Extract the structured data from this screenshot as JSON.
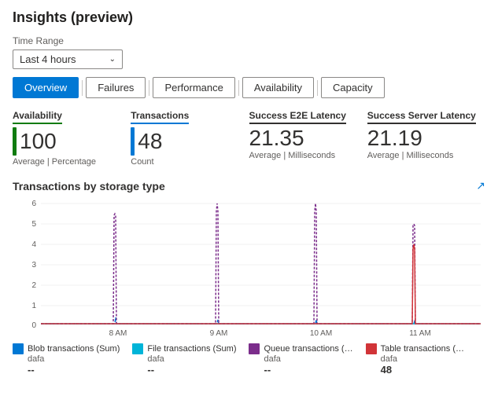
{
  "page": {
    "title": "Insights (preview)"
  },
  "time_range": {
    "label": "Time Range",
    "value": "Last 4 hours"
  },
  "tabs": [
    {
      "id": "overview",
      "label": "Overview",
      "active": true
    },
    {
      "id": "failures",
      "label": "Failures",
      "active": false
    },
    {
      "id": "performance",
      "label": "Performance",
      "active": false
    },
    {
      "id": "availability",
      "label": "Availability",
      "active": false
    },
    {
      "id": "capacity",
      "label": "Capacity",
      "active": false
    }
  ],
  "metrics": [
    {
      "id": "availability",
      "title": "Availability",
      "value": "100",
      "sub": "Average | Percentage",
      "bar_color": "#107c10"
    },
    {
      "id": "transactions",
      "title": "Transactions",
      "value": "48",
      "sub": "Count",
      "bar_color": "#0078d4"
    },
    {
      "id": "e2e_latency",
      "title": "Success E2E Latency",
      "value": "21.35",
      "sub": "Average | Milliseconds",
      "bar_color": null
    },
    {
      "id": "server_latency",
      "title": "Success Server Latency",
      "value": "21.19",
      "sub": "Average | Milliseconds",
      "bar_color": null
    }
  ],
  "chart": {
    "title": "Transactions by storage type",
    "y_labels": [
      "0",
      "1",
      "2",
      "3",
      "4",
      "5",
      "6"
    ],
    "x_labels": [
      "8 AM",
      "9 AM",
      "10 AM",
      "11 AM"
    ],
    "series": [
      {
        "id": "blob",
        "color": "#0078d4",
        "dash": "4,2"
      },
      {
        "id": "file",
        "color": "#00b4d8",
        "dash": "none"
      },
      {
        "id": "queue",
        "color": "#7b2d8b",
        "dash": "4,2"
      },
      {
        "id": "table",
        "color": "#d13438",
        "dash": "none"
      }
    ]
  },
  "legend": [
    {
      "id": "blob",
      "label": "Blob transactions (Sum)",
      "sub": "dafa",
      "value": "--",
      "color": "#0078d4"
    },
    {
      "id": "file",
      "label": "File transactions (Sum)",
      "sub": "dafa",
      "value": "--",
      "color": "#00b4d8"
    },
    {
      "id": "queue",
      "label": "Queue transactions (…",
      "sub": "dafa",
      "value": "--",
      "color": "#7b2d8b"
    },
    {
      "id": "table",
      "label": "Table transactions (…",
      "sub": "dafa",
      "value": "48",
      "color": "#d13438"
    }
  ]
}
